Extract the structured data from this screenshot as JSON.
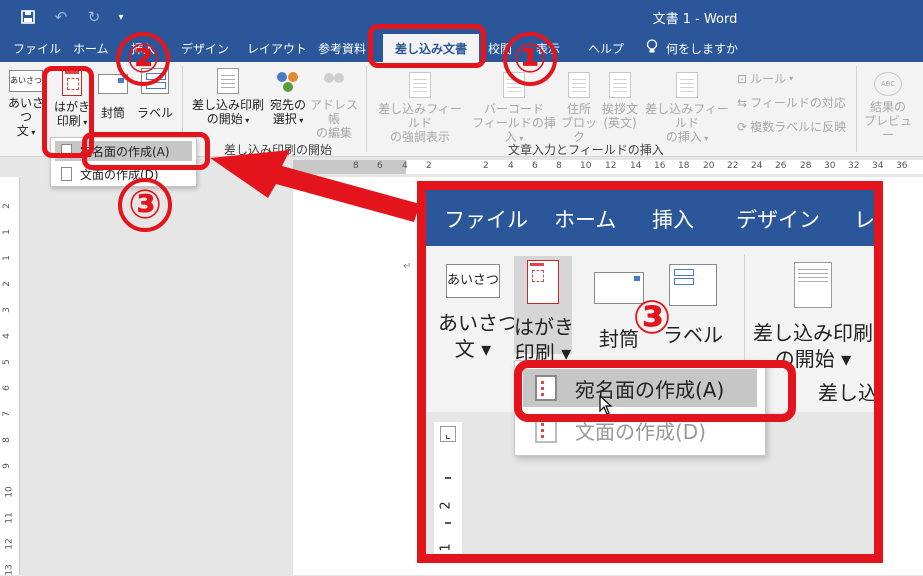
{
  "window": {
    "title": "文書 1  -  Word"
  },
  "quick_access": {
    "save_icon": "save-icon",
    "undo_icon": "undo-icon",
    "redo_icon": "redo-icon",
    "customize_icon": "customize-qat-icon"
  },
  "tabs": [
    {
      "label": "ファイル"
    },
    {
      "label": "ホーム"
    },
    {
      "label": "挿入"
    },
    {
      "label": "デザイン"
    },
    {
      "label": "レイアウト"
    },
    {
      "label": "参考資料"
    },
    {
      "label": "差し込み文書"
    },
    {
      "label": "校閲"
    },
    {
      "label": "表示"
    },
    {
      "label": "ヘルプ"
    }
  ],
  "tell_me": {
    "label": "何をしますか",
    "icon": "lightbulb-icon"
  },
  "ribbon": {
    "create": {
      "greeting_line1": "あいさつ",
      "greeting_line2": "文",
      "postcard_line1": "はがき",
      "postcard_line2": "印刷",
      "envelope": "封筒",
      "labels": "ラベル",
      "greeting_icon_text": "あいさつ"
    },
    "start": {
      "start_line1": "差し込み印刷",
      "start_line2": "の開始",
      "recipients_line1": "宛先の",
      "recipients_line2": "選択",
      "edit_line1": "アドレス帳",
      "edit_line2": "の編集",
      "group_label": "差し込み印刷の開始"
    },
    "fields": {
      "highlight_line1": "差し込みフィールド",
      "highlight_line2": "の強調表示",
      "barcode_line1": "バーコード",
      "barcode_line2": "フィールドの挿入",
      "address_line1": "住所",
      "address_line2": "ブロック",
      "greeting_line1": "挨拶文",
      "greeting_line2": "(英文)",
      "insert_line1": "差し込みフィールド",
      "insert_line2": "の挿入",
      "rules": "ルール",
      "match": "フィールドの対応",
      "update": "複数ラベルに反映",
      "group_label": "文章入力とフィールドの挿入"
    },
    "preview": {
      "line1": "結果の",
      "line2": "プレビュー",
      "icon_text": "ABC"
    }
  },
  "dropdown": {
    "items": [
      {
        "label": "宛名面の作成(A)"
      },
      {
        "label": "文面の作成(D)"
      }
    ]
  },
  "ruler": {
    "h_labels": [
      "8",
      "6",
      "4",
      "2",
      "2",
      "4",
      "6",
      "8",
      "10",
      "12",
      "14",
      "16",
      "18",
      "20",
      "22",
      "24",
      "26",
      "28",
      "30",
      "32",
      "34",
      "36"
    ],
    "v_labels": [
      "2",
      "1",
      "1",
      "2",
      "3",
      "4",
      "5",
      "6",
      "7",
      "8",
      "9",
      "10",
      "11",
      "12",
      "13"
    ]
  },
  "annotations": {
    "step1": "①",
    "step2": "②",
    "step3": "③"
  },
  "zoom": {
    "tabs": [
      "ファイル",
      "ホーム",
      "挿入",
      "デザイン",
      "レ"
    ],
    "greeting_line1": "あいさつ",
    "greeting_line2": "文 ▾",
    "postcard_line1": "はがき",
    "postcard_line2": "印刷 ▾",
    "envelope": "封筒",
    "labels": "ラベル",
    "start_line1": "差し込み印刷",
    "start_line2": "の開始 ▾",
    "group_label": "差し込",
    "ruler_labels": [
      "2",
      "1"
    ],
    "greeting_icon_text": "あいさつ"
  },
  "colors": {
    "word_blue": "#2b579a",
    "annotation_red": "#e3141c"
  }
}
